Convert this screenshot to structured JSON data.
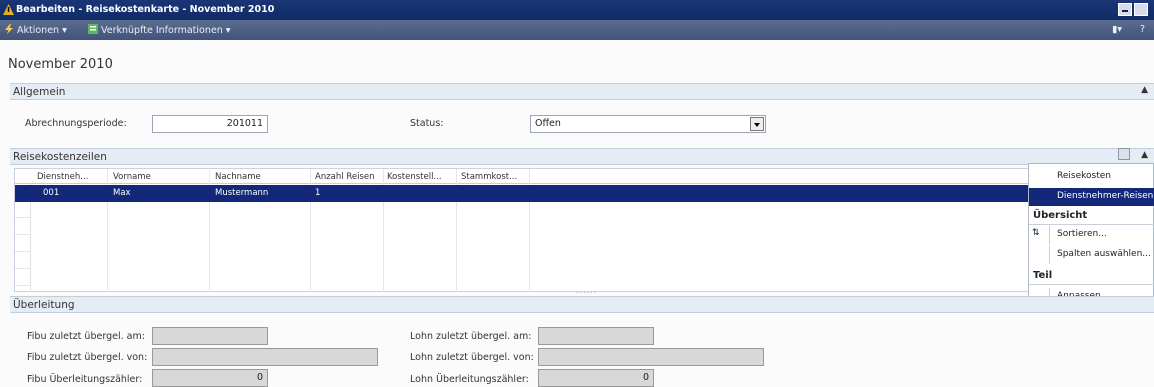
{
  "window": {
    "title": "Bearbeiten - Reisekostenkarte - November 2010"
  },
  "toolbar": {
    "actions_label": "Aktionen",
    "related_label": "Verknüpfte Informationen"
  },
  "page_title": "November 2010",
  "general": {
    "header": "Allgemein",
    "period_label": "Abrechnungsperiode:",
    "period_value": "201011",
    "status_label": "Status:",
    "status_value": "Offen"
  },
  "lines": {
    "header": "Reisekostenzeilen",
    "columns": [
      "Dienstneh...",
      "Vorname",
      "Nachname",
      "Anzahl Reisen",
      "Kostenstell...",
      "Stammkost..."
    ],
    "rows": [
      {
        "employee": "001",
        "first_name": "Max",
        "last_name": "Mustermann",
        "trips": "1",
        "cost_center": "",
        "master_cost": ""
      }
    ]
  },
  "context_menu": {
    "items_top": [
      "Reisekosten",
      "Dienstnehmer-Reisen"
    ],
    "section_overview": "Übersicht",
    "overview_items": [
      "Sortieren...",
      "Spalten auswählen..."
    ],
    "section_part": "Teil",
    "part_items": [
      "Anpassen..."
    ]
  },
  "transfer": {
    "header": "Überleitung",
    "fibu_last_on_label": "Fibu zuletzt übergel. am:",
    "fibu_last_on_value": "",
    "fibu_last_by_label": "Fibu zuletzt übergel. von:",
    "fibu_last_by_value": "",
    "fibu_counter_label": "Fibu Überleitungszähler:",
    "fibu_counter_value": "0",
    "lohn_last_on_label": "Lohn zuletzt übergel. am:",
    "lohn_last_on_value": "",
    "lohn_last_by_label": "Lohn zuletzt übergel. von:",
    "lohn_last_by_value": "",
    "lohn_counter_label": "Lohn Überleitungszähler:",
    "lohn_counter_value": "0"
  },
  "colors": {
    "titlebar": "#1b3676",
    "toolbar": "#4a5c82",
    "selection": "#14287a",
    "section": "#e6ecf3"
  }
}
